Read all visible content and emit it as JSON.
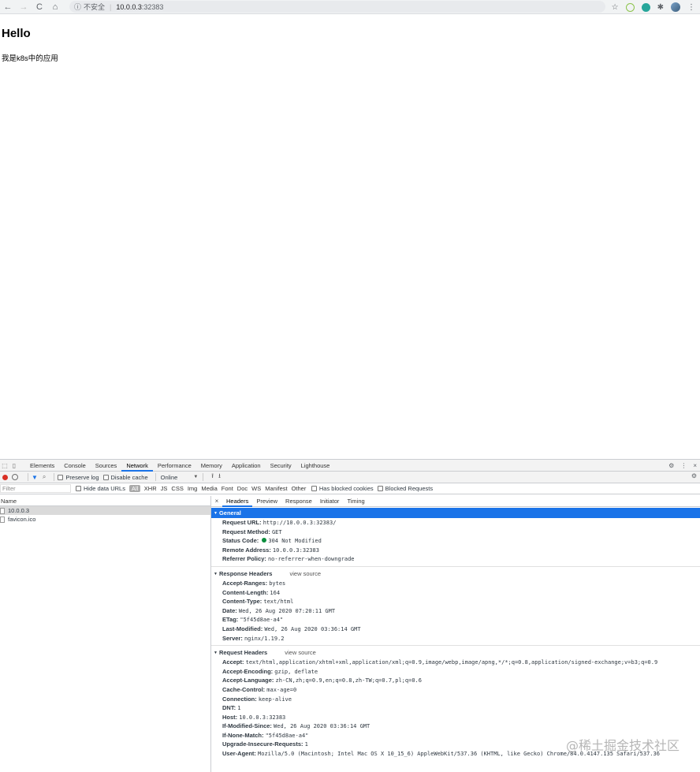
{
  "browser": {
    "nav": {
      "back_icon": "←",
      "forward_icon": "→",
      "reload_icon": "C",
      "home_icon": "⌂"
    },
    "address": {
      "security_label": "不安全",
      "host": "10.0.0.3",
      "port": ":32383"
    }
  },
  "page": {
    "heading": "Hello",
    "text": "我是k8s中的应用"
  },
  "devtools": {
    "tabs": [
      "Elements",
      "Console",
      "Sources",
      "Network",
      "Performance",
      "Memory",
      "Application",
      "Security",
      "Lighthouse"
    ],
    "active_tab": "Network",
    "toolbar": {
      "preserve_log": "Preserve log",
      "disable_cache": "Disable cache",
      "throttle": "Online"
    },
    "filter": {
      "placeholder": "Filter",
      "hide_data_urls": "Hide data URLs",
      "types": [
        "All",
        "XHR",
        "JS",
        "CSS",
        "Img",
        "Media",
        "Font",
        "Doc",
        "WS",
        "Manifest",
        "Other"
      ],
      "blocked_cookies": "Has blocked cookies",
      "blocked_requests": "Blocked Requests"
    },
    "requests": {
      "header": "Name",
      "rows": [
        "10.0.0.3",
        "favicon.ico"
      ]
    },
    "details": {
      "close": "×",
      "tabs": [
        "Headers",
        "Preview",
        "Response",
        "Initiator",
        "Timing"
      ],
      "general": {
        "title": "General",
        "rows": [
          {
            "key": "Request URL:",
            "value": "http://10.0.0.3:32383/"
          },
          {
            "key": "Request Method:",
            "value": "GET"
          },
          {
            "key": "Status Code:",
            "value": "304 Not Modified"
          },
          {
            "key": "Remote Address:",
            "value": "10.0.0.3:32383"
          },
          {
            "key": "Referrer Policy:",
            "value": "no-referrer-when-downgrade"
          }
        ]
      },
      "response_headers": {
        "title": "Response Headers",
        "view_source": "view source",
        "rows": [
          {
            "key": "Accept-Ranges:",
            "value": "bytes"
          },
          {
            "key": "Content-Length:",
            "value": "164"
          },
          {
            "key": "Content-Type:",
            "value": "text/html"
          },
          {
            "key": "Date:",
            "value": "Wed, 26 Aug 2020 07:20:11 GMT"
          },
          {
            "key": "ETag:",
            "value": "\"5f45d8ae-a4\""
          },
          {
            "key": "Last-Modified:",
            "value": "Wed, 26 Aug 2020 03:36:14 GMT"
          },
          {
            "key": "Server:",
            "value": "nginx/1.19.2"
          }
        ]
      },
      "request_headers": {
        "title": "Request Headers",
        "view_source": "view source",
        "rows": [
          {
            "key": "Accept:",
            "value": "text/html,application/xhtml+xml,application/xml;q=0.9,image/webp,image/apng,*/*;q=0.8,application/signed-exchange;v=b3;q=0.9"
          },
          {
            "key": "Accept-Encoding:",
            "value": "gzip, deflate"
          },
          {
            "key": "Accept-Language:",
            "value": "zh-CN,zh;q=0.9,en;q=0.8,zh-TW;q=0.7,pl;q=0.6"
          },
          {
            "key": "Cache-Control:",
            "value": "max-age=0"
          },
          {
            "key": "Connection:",
            "value": "keep-alive"
          },
          {
            "key": "DNT:",
            "value": "1"
          },
          {
            "key": "Host:",
            "value": "10.0.0.3:32383"
          },
          {
            "key": "If-Modified-Since:",
            "value": "Wed, 26 Aug 2020 03:36:14 GMT"
          },
          {
            "key": "If-None-Match:",
            "value": "\"5f45d8ae-a4\""
          },
          {
            "key": "Upgrade-Insecure-Requests:",
            "value": "1"
          },
          {
            "key": "User-Agent:",
            "value": "Mozilla/5.0 (Macintosh; Intel Mac OS X 10_15_6) AppleWebKit/537.36 (KHTML, like Gecko) Chrome/84.0.4147.135 Safari/537.36"
          }
        ]
      }
    }
  },
  "watermark": "@稀土掘金技术社区",
  "colors": {
    "accent": "#1a73e8",
    "record": "#d93025",
    "status_ok": "#0c8e3e"
  }
}
